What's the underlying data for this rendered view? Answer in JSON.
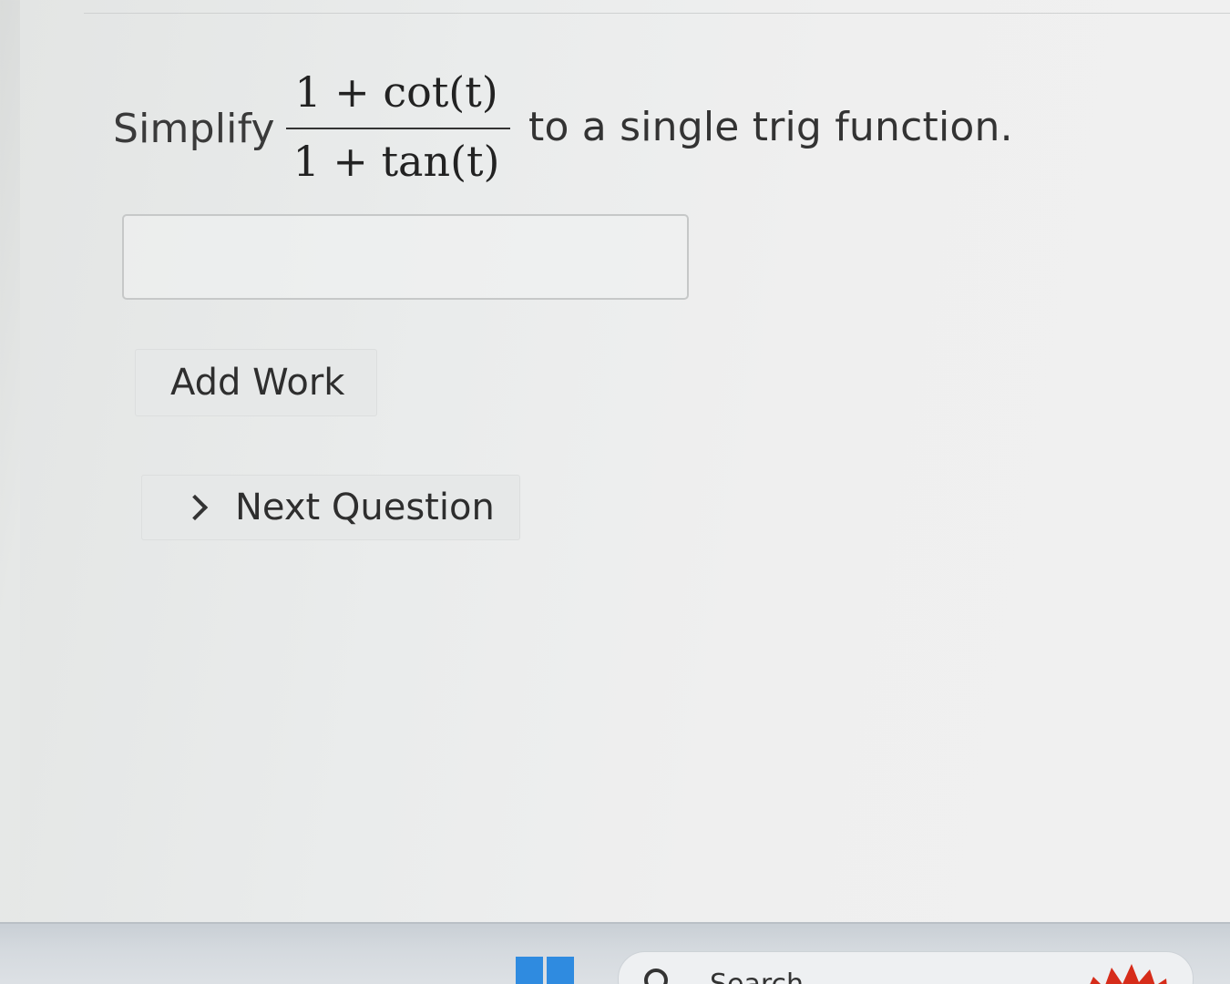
{
  "question": {
    "prefix": "Simplify",
    "fraction": {
      "numerator": "1 + cot(t)",
      "denominator": "1 + tan(t)"
    },
    "suffix": "to a single trig function."
  },
  "answer": {
    "value": "",
    "placeholder": ""
  },
  "buttons": {
    "add_work": "Add Work",
    "next_question": "Next Question"
  },
  "taskbar": {
    "search_label": "Search",
    "start_icon": "windows-start-icon",
    "tray_icon": "flower-icon"
  },
  "colors": {
    "start_blue": "#2f8be0",
    "tray_red": "#d62c1a"
  }
}
